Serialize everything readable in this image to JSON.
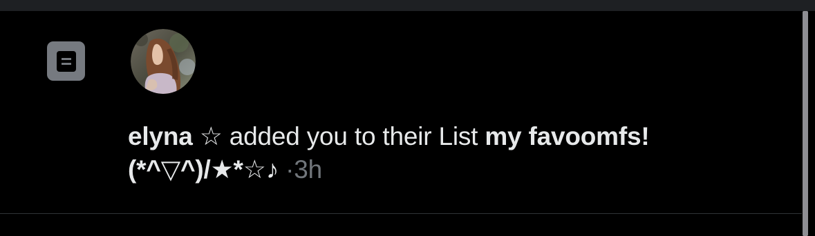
{
  "notification": {
    "icon": "list-icon",
    "avatar": "user-avatar-photo",
    "user_name": "elyna ☆",
    "action_text": "added you to their List",
    "list_name_part1": "my favoomfs!",
    "list_name_part2": "(*^▽^)/★*☆♪",
    "separator": "·",
    "timestamp": "3h"
  },
  "colors": {
    "background": "#000000",
    "text_primary": "#e7e9ea",
    "text_secondary": "#71767b",
    "icon_box": "#767a80",
    "divider": "#2f3336"
  }
}
